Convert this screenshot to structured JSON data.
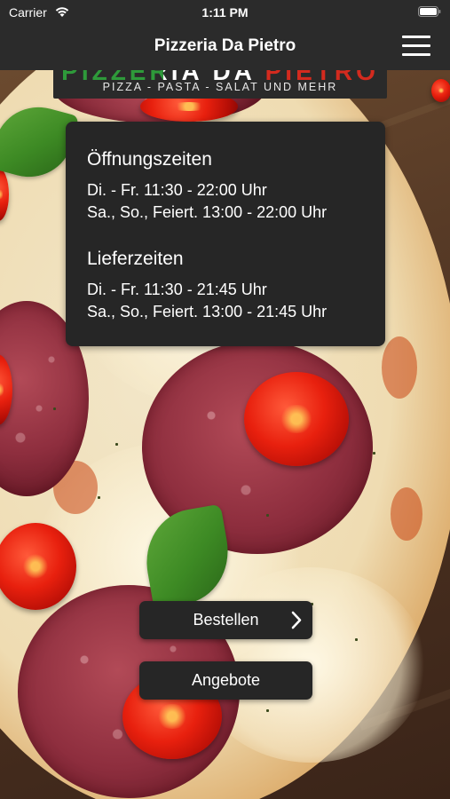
{
  "status_bar": {
    "carrier": "Carrier",
    "time": "1:11 PM"
  },
  "nav": {
    "title": "Pizzeria Da Pietro",
    "menu_icon": "hamburger-menu-icon"
  },
  "logo": {
    "name": "PIZZERIA DA PIETRO",
    "tagline": "PIZZA - PASTA - SALAT UND MEHR"
  },
  "opening_hours": {
    "title": "Öffnungszeiten",
    "lines": [
      "Di. - Fr. 11:30 - 22:00 Uhr",
      "Sa., So., Feiert. 13:00 - 22:00 Uhr"
    ]
  },
  "delivery_hours": {
    "title": "Lieferzeiten",
    "lines": [
      "Di. - Fr. 11:30 - 21:45 Uhr",
      "Sa., So., Feiert. 13:00 - 21:45 Uhr"
    ]
  },
  "buttons": {
    "order": "Bestellen",
    "offers": "Angebote"
  },
  "colors": {
    "bar": "#2b2b2b",
    "card": "#262626",
    "text": "#ffffff"
  }
}
